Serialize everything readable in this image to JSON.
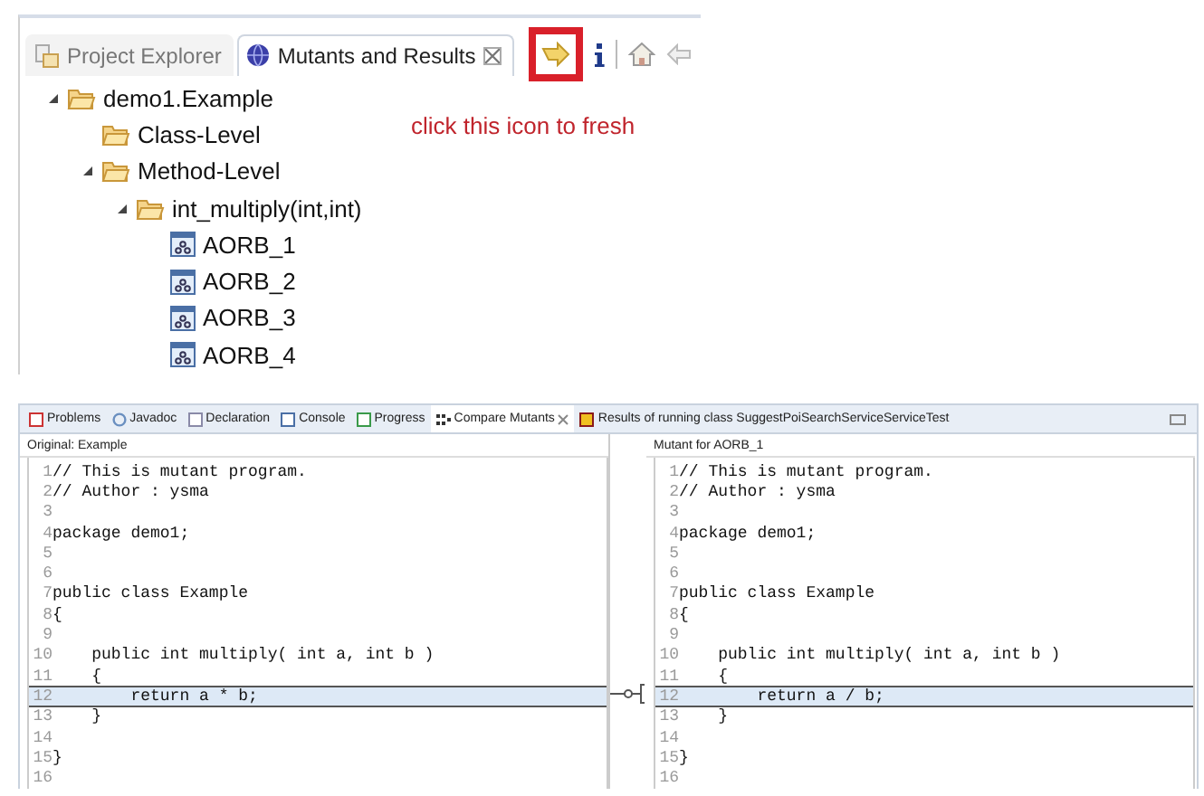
{
  "top_view": {
    "tabs": [
      {
        "label": "Project Explorer",
        "selected": false,
        "closable": false
      },
      {
        "label": "Mutants and Results",
        "selected": true,
        "closable": true
      }
    ],
    "annotation": "click this icon to fresh",
    "tree": [
      {
        "label": "demo1.Example",
        "kind": "folder",
        "expanded": true,
        "children": [
          {
            "label": "Class-Level",
            "kind": "folder"
          },
          {
            "label": "Method-Level",
            "kind": "folder",
            "expanded": true,
            "children": [
              {
                "label": "int_multiply(int,int)",
                "kind": "folder",
                "expanded": true,
                "children": [
                  {
                    "label": "AORB_1",
                    "kind": "mutant"
                  },
                  {
                    "label": "AORB_2",
                    "kind": "mutant"
                  },
                  {
                    "label": "AORB_3",
                    "kind": "mutant"
                  },
                  {
                    "label": "AORB_4",
                    "kind": "mutant"
                  }
                ]
              }
            ]
          }
        ]
      }
    ]
  },
  "bottom_view": {
    "tabs": [
      {
        "label": "Problems",
        "kind": "problems",
        "selected": false,
        "closable": false
      },
      {
        "label": "Javadoc",
        "kind": "javadoc",
        "selected": false,
        "closable": false
      },
      {
        "label": "Declaration",
        "kind": "declaration",
        "selected": false,
        "closable": false
      },
      {
        "label": "Console",
        "kind": "console",
        "selected": false,
        "closable": false
      },
      {
        "label": "Progress",
        "kind": "progress",
        "selected": false,
        "closable": false
      },
      {
        "label": "Compare Mutants",
        "kind": "compare",
        "selected": true,
        "closable": true
      },
      {
        "label": "Results of running class SuggestPoiSearchServiceServiceTest",
        "kind": "results",
        "selected": false,
        "closable": false
      }
    ],
    "panes": [
      {
        "title": "Original: Example",
        "lines": [
          {
            "number": "1",
            "code": "// This is mutant program.",
            "selected": false
          },
          {
            "number": "2",
            "code": "// Author : ysma",
            "selected": false
          },
          {
            "number": "3",
            "selected": false
          },
          {
            "number": "4",
            "code": "package demo1;",
            "selected": false
          },
          {
            "number": "5",
            "selected": false
          },
          {
            "number": "6",
            "selected": false
          },
          {
            "number": "7",
            "code": "public class Example",
            "selected": false
          },
          {
            "number": "8",
            "code": "{",
            "selected": false
          },
          {
            "number": "9",
            "selected": false
          },
          {
            "number": "10",
            "code": "    public int multiply( int a, int b )",
            "selected": false
          },
          {
            "number": "11",
            "code": "    {",
            "selected": false
          },
          {
            "number": "12",
            "code": "        return a * b;",
            "selected": true
          },
          {
            "number": "13",
            "code": "    }",
            "selected": false
          },
          {
            "number": "14",
            "selected": false
          },
          {
            "number": "15",
            "code": "}",
            "selected": false
          },
          {
            "number": "16",
            "selected": false
          }
        ]
      },
      {
        "title": "Mutant for AORB_1",
        "lines": [
          {
            "number": "1",
            "code": "// This is mutant program.",
            "selected": false
          },
          {
            "number": "2",
            "code": "// Author : ysma",
            "selected": false
          },
          {
            "number": "3",
            "selected": false
          },
          {
            "number": "4",
            "code": "package demo1;",
            "selected": false
          },
          {
            "number": "5",
            "selected": false
          },
          {
            "number": "6",
            "selected": false
          },
          {
            "number": "7",
            "code": "public class Example",
            "selected": false
          },
          {
            "number": "8",
            "code": "{",
            "selected": false
          },
          {
            "number": "9",
            "selected": false
          },
          {
            "number": "10",
            "code": "    public int multiply( int a, int b )",
            "selected": false
          },
          {
            "number": "11",
            "code": "    {",
            "selected": false
          },
          {
            "number": "12",
            "code": "        return a / b;",
            "selected": true
          },
          {
            "number": "13",
            "code": "    }",
            "selected": false
          },
          {
            "number": "14",
            "selected": false
          },
          {
            "number": "15",
            "code": "}",
            "selected": false
          },
          {
            "number": "16",
            "selected": false
          }
        ]
      }
    ]
  }
}
